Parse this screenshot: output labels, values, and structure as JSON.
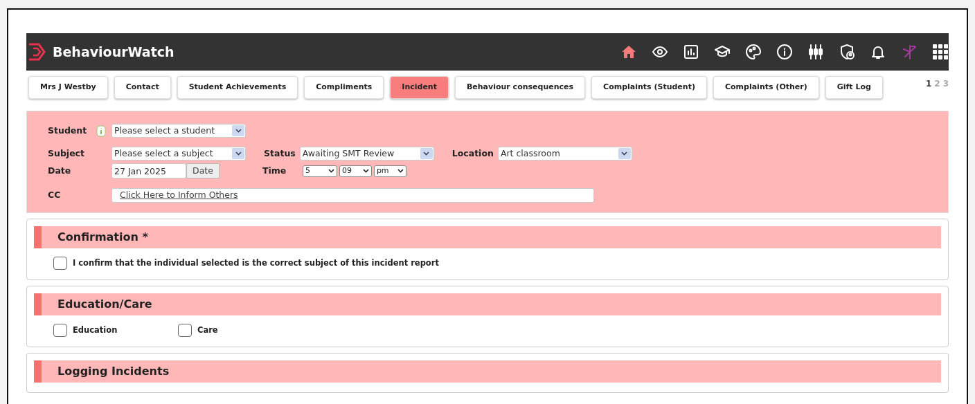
{
  "app": {
    "title": "BehaviourWatch"
  },
  "nav_icons": [
    {
      "kind": "home",
      "selected": true
    },
    {
      "kind": "eye",
      "selected": false
    },
    {
      "kind": "chart",
      "selected": false
    },
    {
      "kind": "cap",
      "selected": false
    },
    {
      "kind": "palette",
      "selected": false
    },
    {
      "kind": "info",
      "selected": false
    },
    {
      "kind": "sliders",
      "selected": false
    },
    {
      "kind": "shield",
      "selected": false
    },
    {
      "kind": "bell",
      "selected": false
    },
    {
      "kind": "figure",
      "selected": false
    },
    {
      "kind": "grid",
      "selected": false
    }
  ],
  "tabs": [
    {
      "label": "Mrs J Westby",
      "selected": false
    },
    {
      "label": "Contact",
      "selected": false
    },
    {
      "label": "Student Achievements",
      "selected": false
    },
    {
      "label": "Compliments",
      "selected": false
    },
    {
      "label": "Incident",
      "selected": true
    },
    {
      "label": "Behaviour consequences",
      "selected": false
    },
    {
      "label": "Complaints (Student)",
      "selected": false
    },
    {
      "label": "Complaints (Other)",
      "selected": false
    },
    {
      "label": "Gift Log",
      "selected": false
    }
  ],
  "pages": [
    {
      "label": "1",
      "selected": true
    },
    {
      "label": "2",
      "selected": false
    },
    {
      "label": "3",
      "selected": false
    }
  ],
  "form": {
    "student": {
      "label": "Student",
      "value": "Please select a student"
    },
    "subject": {
      "label": "Subject",
      "value": "Please select a subject"
    },
    "status": {
      "label": "Status",
      "value": "Awaiting SMT Review"
    },
    "location": {
      "label": "Location",
      "value": "Art classroom"
    },
    "date": {
      "label": "Date",
      "value": "27 Jan 2025",
      "button": "Date"
    },
    "time": {
      "label": "Time",
      "hour": "5",
      "minute": "09",
      "ampm": "pm"
    },
    "cc": {
      "label": "CC",
      "link": "Click Here to Inform Others"
    }
  },
  "sections": [
    {
      "title": "Confirmation *",
      "options": [
        {
          "label": "I confirm that the individual selected is the correct subject of this incident report",
          "checked": false
        }
      ]
    },
    {
      "title": "Education/Care",
      "options": [
        {
          "label": "Education",
          "checked": false
        },
        {
          "label": "Care",
          "checked": false
        }
      ]
    },
    {
      "title": "Logging Incidents"
    }
  ]
}
